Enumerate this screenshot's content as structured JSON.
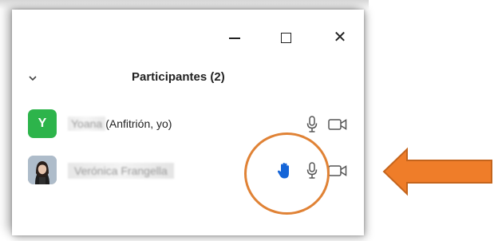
{
  "window": {
    "controls": {
      "minimize": "minimize-icon",
      "maximize": "maximize-icon",
      "close": "close-icon"
    }
  },
  "panel": {
    "title": "Participantes (2)",
    "collapse_icon": "chevron-down-icon"
  },
  "participants": [
    {
      "avatar_letter": "Y",
      "avatar_color": "#2db44b",
      "name": "Yoana",
      "role": "(Anfitrión, yo)",
      "icons": [
        "microphone-icon",
        "video-camera-icon"
      ]
    },
    {
      "avatar": "profile-photo",
      "name": "Verónica Frangella",
      "icons": [
        "raised-hand-icon",
        "microphone-icon",
        "video-camera-icon"
      ],
      "hand_color": "#1565d8"
    }
  ],
  "annotation": {
    "circle_color": "#e08235",
    "arrow_color": "#ef7d29",
    "arrow_outline": "#c4641c"
  }
}
